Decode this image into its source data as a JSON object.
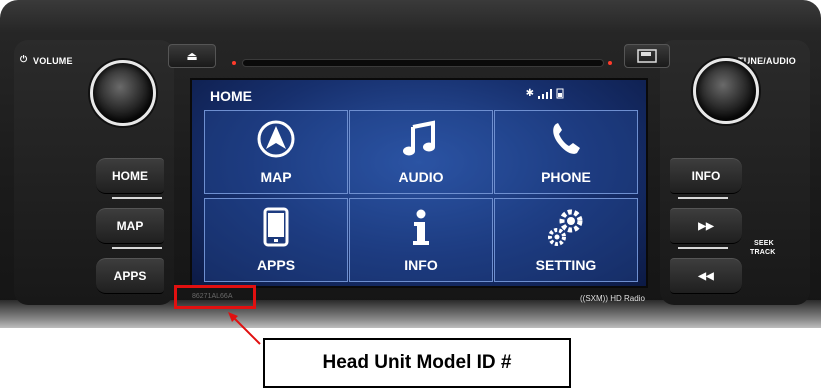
{
  "hardware": {
    "volume_label": "VOLUME",
    "tune_label": "TUNE/AUDIO",
    "left_buttons": [
      "HOME",
      "MAP",
      "APPS"
    ],
    "right_buttons": [
      "INFO",
      "▶▶",
      "◀◀"
    ],
    "seek_label_1": "SEEK",
    "seek_label_2": "TRACK",
    "eject_symbol": "⏏"
  },
  "screen": {
    "title": "HOME",
    "tiles": [
      {
        "label": "MAP",
        "icon": "navigation-arrow-icon"
      },
      {
        "label": "AUDIO",
        "icon": "music-note-icon"
      },
      {
        "label": "PHONE",
        "icon": "phone-icon"
      },
      {
        "label": "APPS",
        "icon": "tablet-icon"
      },
      {
        "label": "INFO",
        "icon": "info-icon"
      },
      {
        "label": "SETTING",
        "icon": "gears-icon"
      }
    ]
  },
  "model_id_text": "86271AL66A",
  "radio_logo_text": "((SXM)) HD Radio",
  "callout": {
    "text": "Head Unit Model ID #"
  },
  "colors": {
    "highlight": "#e11010",
    "screen_blue": "#17306e"
  }
}
